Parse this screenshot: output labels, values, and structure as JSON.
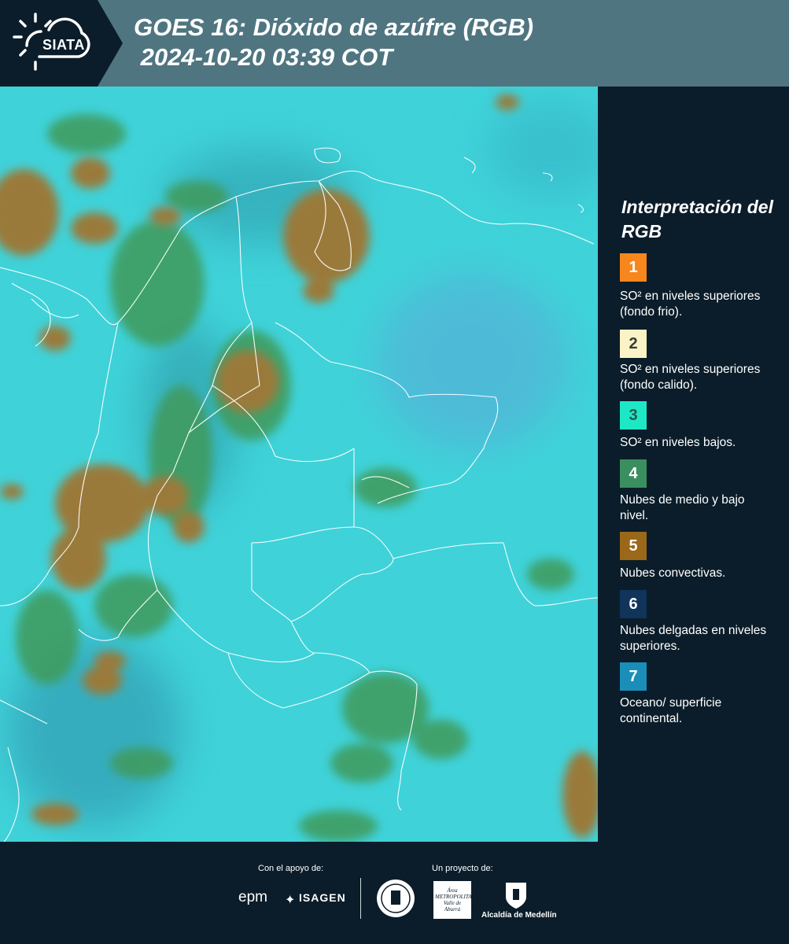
{
  "header": {
    "logo_text": "SIATA",
    "title_line1": "GOES 16: Dióxido de azúfre (RGB)",
    "title_line2": " 2024-10-20 03:39 COT",
    "band_color": "#4f7580"
  },
  "legend": {
    "title": "Interpretación del RGB",
    "items": [
      {
        "number": "1",
        "color": "#f7861d",
        "number_color": "#ffffff",
        "label": "SO² en niveles superiores (fondo frio)."
      },
      {
        "number": "2",
        "color": "#fbf3c5",
        "number_color": "#3a3a3a",
        "label": "SO² en niveles superiores (fondo calido)."
      },
      {
        "number": "3",
        "color": "#1de8c6",
        "number_color": "#2e5650",
        "label": "SO² en niveles bajos."
      },
      {
        "number": "4",
        "color": "#3a8f5f",
        "number_color": "#ffffff",
        "label": "Nubes de medio y bajo nivel."
      },
      {
        "number": "5",
        "color": "#9a6818",
        "number_color": "#ffffff",
        "label": "Nubes convectivas."
      },
      {
        "number": "6",
        "color": "#10345a",
        "number_color": "#ffffff",
        "label": "Nubes delgadas en niveles superiores."
      },
      {
        "number": "7",
        "color": "#1a8eb8",
        "number_color": "#ffffff",
        "label": "Oceano/ superficie continental."
      }
    ]
  },
  "footer": {
    "support_label": "Con el apoyo de:",
    "project_label": "Un proyecto de:",
    "sponsor1": "epm",
    "sponsor2": "ISAGEN",
    "partner1": "MEDELLÍN",
    "partner2": "Área METROPOLITANA Valle de Aburrá",
    "partner3": "Alcaldía de Medellín"
  },
  "map": {
    "background_color": "#3fd2d9",
    "cloud_colors": [
      "#9a7a3a",
      "#3f9a5a",
      "#2e8fa0"
    ]
  }
}
